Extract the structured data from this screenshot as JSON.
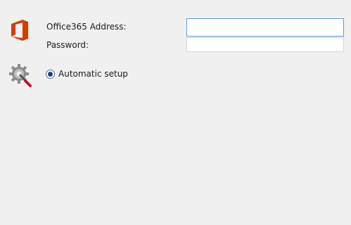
{
  "form": {
    "address_label": "Office365 Address:",
    "address_value": "",
    "password_label": "Password:",
    "password_value": ""
  },
  "setup": {
    "option_label": "Automatic setup",
    "selected": true
  },
  "icons": {
    "app": "office-logo-icon",
    "setup": "gear-wrench-icon"
  },
  "colors": {
    "office_red": "#d83b01",
    "focus_border": "#5b9bd5",
    "radio_fill": "#17447a"
  }
}
